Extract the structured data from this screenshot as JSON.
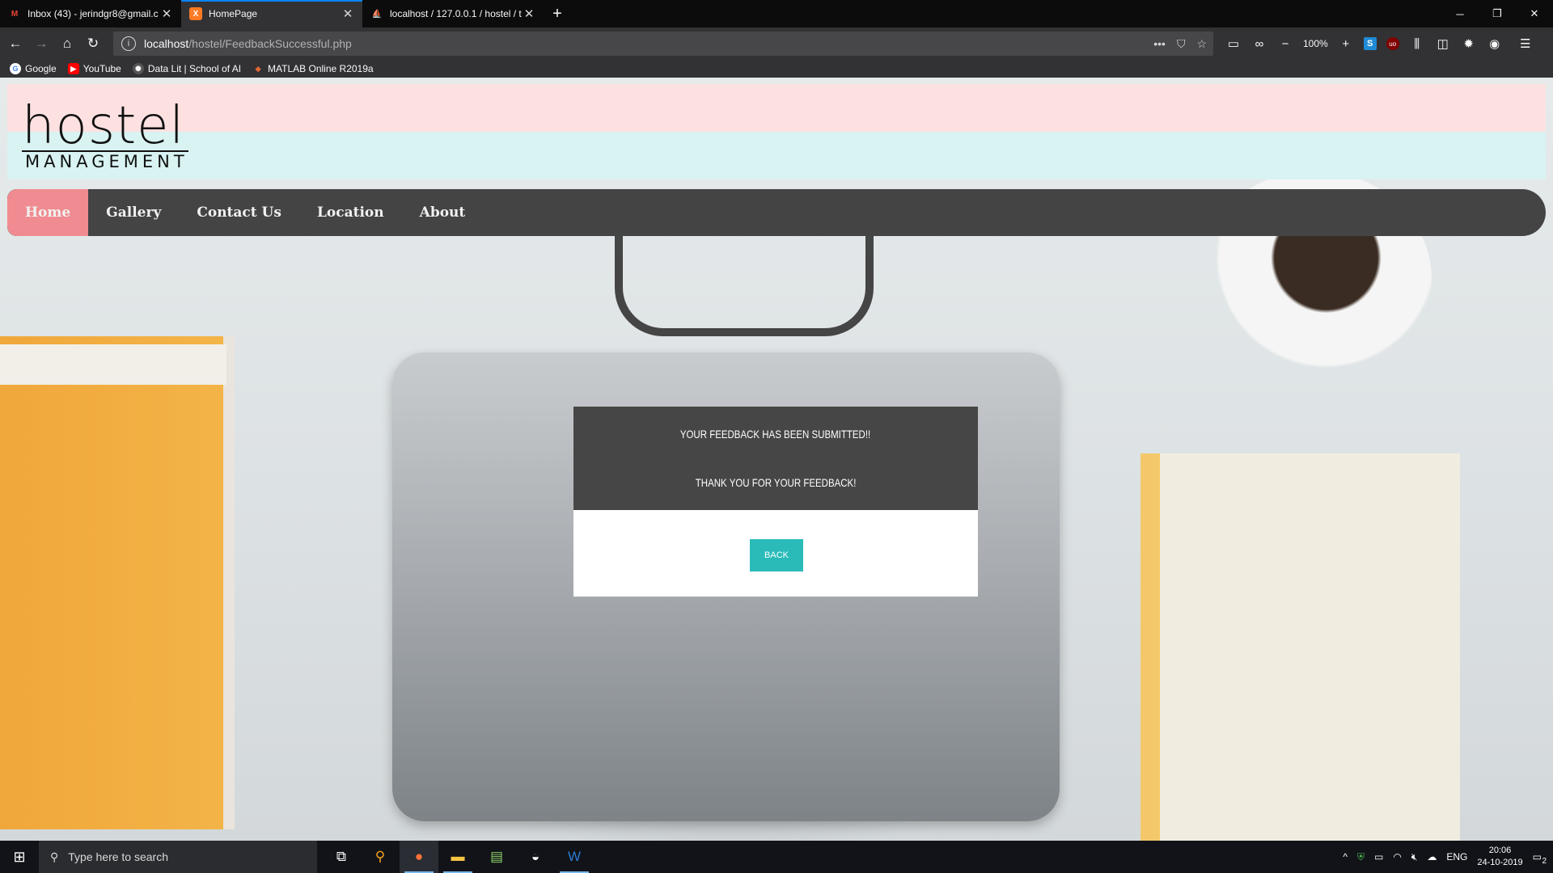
{
  "browser": {
    "tabs": [
      {
        "title": "Inbox (43) - jerindgr8@gmail.c",
        "icon": "gmail-icon",
        "active": false
      },
      {
        "title": "HomePage",
        "icon": "xampp-icon",
        "active": true
      },
      {
        "title": "localhost / 127.0.0.1 / hostel / t",
        "icon": "phpmyadmin-icon",
        "active": false
      }
    ],
    "new_tab": "+",
    "url_host": "localhost",
    "url_path": "/hostel/FeedbackSuccessful.php",
    "zoom": "100%",
    "bookmarks": [
      {
        "label": "Google",
        "icon": "google-icon",
        "color": "#4285f4"
      },
      {
        "label": "YouTube",
        "icon": "youtube-icon",
        "color": "#ff0000"
      },
      {
        "label": "Data Lit | School of AI",
        "icon": "school-of-ai-icon",
        "color": "#444444"
      },
      {
        "label": "MATLAB Online R2019a",
        "icon": "matlab-icon",
        "color": "#e16737"
      }
    ]
  },
  "site": {
    "logo_word": "hostel",
    "logo_sub": "MANAGEMENT",
    "menu": [
      {
        "label": "Home",
        "active": true
      },
      {
        "label": "Gallery",
        "active": false
      },
      {
        "label": "Contact Us",
        "active": false
      },
      {
        "label": "Location",
        "active": false
      },
      {
        "label": "About",
        "active": false
      }
    ],
    "message_line1": "YOUR FEEDBACK HAS BEEN SUBMITTED!!",
    "message_line2": "THANK YOU FOR YOUR FEEDBACK!",
    "back_label": "BACK",
    "colors": {
      "active_menu": "#f08c91",
      "menu_bg": "#444444",
      "button": "#2abbb9",
      "header_pink": "#fde1e1",
      "header_cyan": "#d8f3f2"
    }
  },
  "taskbar": {
    "search_placeholder": "Type here to search",
    "lang": "ENG",
    "time": "20:06",
    "date": "24-10-2019",
    "notification_count": "2"
  }
}
